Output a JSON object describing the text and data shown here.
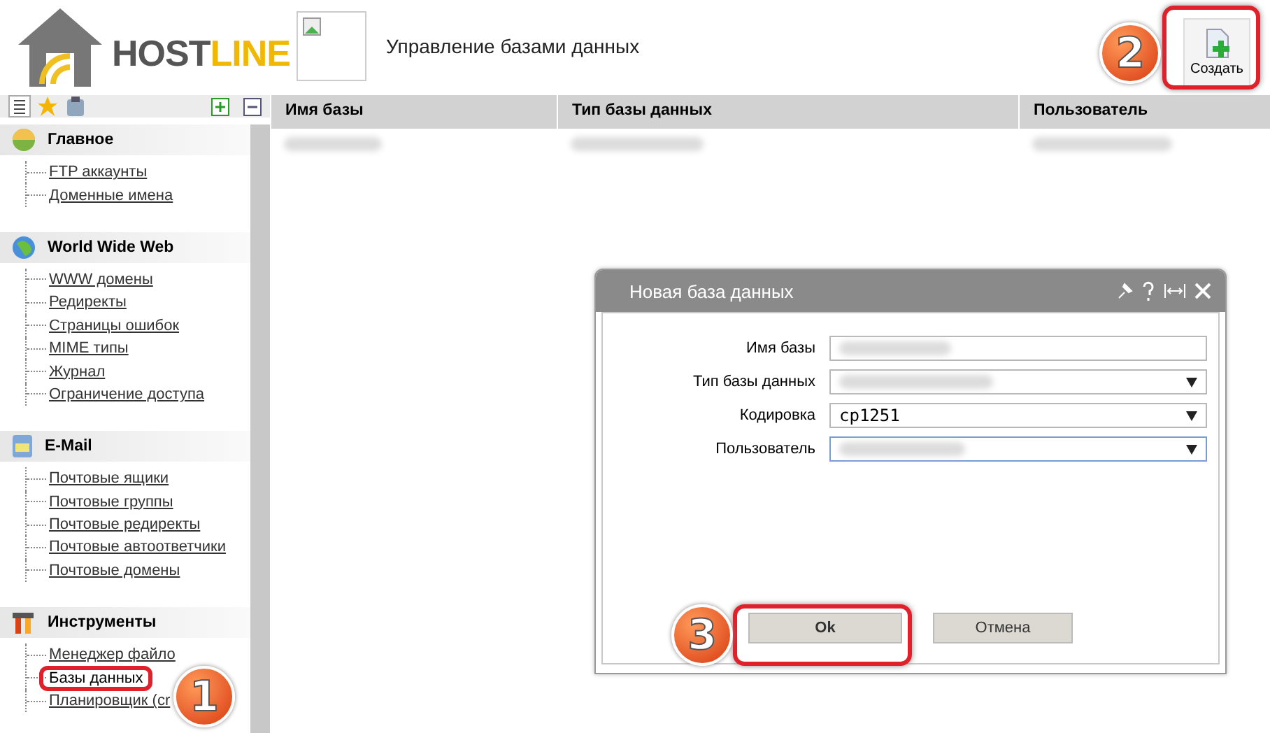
{
  "logo": {
    "text_1": "HOST",
    "text_2": "LINE"
  },
  "header": {
    "title": "Управление базами данных",
    "create_button": "Создать"
  },
  "sidebar": {
    "groups": [
      {
        "kind": "home",
        "title": "Главное",
        "items": [
          {
            "label": "FTP аккаунты",
            "selected": false
          },
          {
            "label": "Доменные имена",
            "selected": false
          }
        ]
      },
      {
        "kind": "web",
        "title": "World Wide Web",
        "items": [
          {
            "label": "WWW домены",
            "selected": false
          },
          {
            "label": "Редиректы",
            "selected": false
          },
          {
            "label": "Страницы ошибок",
            "selected": false
          },
          {
            "label": "MIME типы",
            "selected": false
          },
          {
            "label": "Журнал",
            "selected": false
          },
          {
            "label": "Ограничение доступа",
            "selected": false
          }
        ]
      },
      {
        "kind": "mail",
        "title": "E-Mail",
        "items": [
          {
            "label": "Почтовые ящики",
            "selected": false
          },
          {
            "label": "Почтовые группы",
            "selected": false
          },
          {
            "label": "Почтовые редиректы",
            "selected": false
          },
          {
            "label": "Почтовые автоответчики",
            "selected": false
          },
          {
            "label": "Почтовые домены",
            "selected": false
          }
        ]
      },
      {
        "kind": "tools",
        "title": "Инструменты",
        "items": [
          {
            "label": "Менеджер файло",
            "selected": false
          },
          {
            "label": "Базы данных",
            "selected": true
          },
          {
            "label": "Планировщик (cr",
            "selected": false
          }
        ]
      }
    ]
  },
  "table": {
    "columns": [
      "Имя базы",
      "Тип базы данных",
      "Пользователь"
    ],
    "rows": [
      {
        "cells": [
          {
            "kind": "blurred"
          },
          {
            "kind": "blurred"
          },
          {
            "kind": "blurred"
          }
        ]
      }
    ]
  },
  "dialog": {
    "title": "Новая база данных",
    "fields": [
      {
        "kind": "text",
        "label": "Имя базы",
        "blurred": true,
        "focused": false
      },
      {
        "kind": "select",
        "label": "Тип базы данных",
        "blurred": true,
        "focused": false
      },
      {
        "kind": "select",
        "label": "Кодировка",
        "value": "cp1251",
        "focused": false
      },
      {
        "kind": "select",
        "label": "Пользователь",
        "blurred": true,
        "focused": true
      }
    ],
    "buttons": [
      {
        "label": "Ok",
        "primary": true
      },
      {
        "label": "Отмена",
        "primary": false
      }
    ]
  },
  "callouts": [
    {
      "number": "1"
    },
    {
      "number": "2"
    },
    {
      "number": "3"
    }
  ]
}
